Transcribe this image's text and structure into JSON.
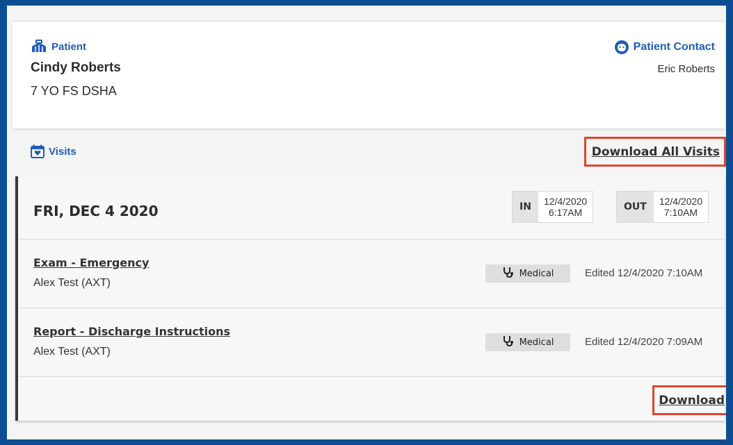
{
  "patient": {
    "label": "Patient",
    "name": "Cindy Roberts",
    "description": "7 YO FS DSHA"
  },
  "contact": {
    "label": "Patient Contact",
    "name": "Eric Roberts"
  },
  "visits": {
    "label": "Visits",
    "download_all_label": "Download All Visits"
  },
  "visit": {
    "date": "FRI, DEC 4 2020",
    "in": {
      "tag": "IN",
      "date": "12/4/2020",
      "time": "6:17AM"
    },
    "out": {
      "tag": "OUT",
      "date": "12/4/2020",
      "time": "7:10AM"
    },
    "entries": [
      {
        "title": "Exam - Emergency",
        "author": "Alex Test (AXT)",
        "badge": "Medical",
        "edited": "Edited 12/4/2020 7:10AM"
      },
      {
        "title": "Report - Discharge Instructions",
        "author": "Alex Test (AXT)",
        "badge": "Medical",
        "edited": "Edited 12/4/2020 7:09AM"
      }
    ],
    "download_label": "Download"
  },
  "colors": {
    "frame": "#0d4e92",
    "accent": "#1f5db8",
    "highlight": "#e0432b"
  }
}
